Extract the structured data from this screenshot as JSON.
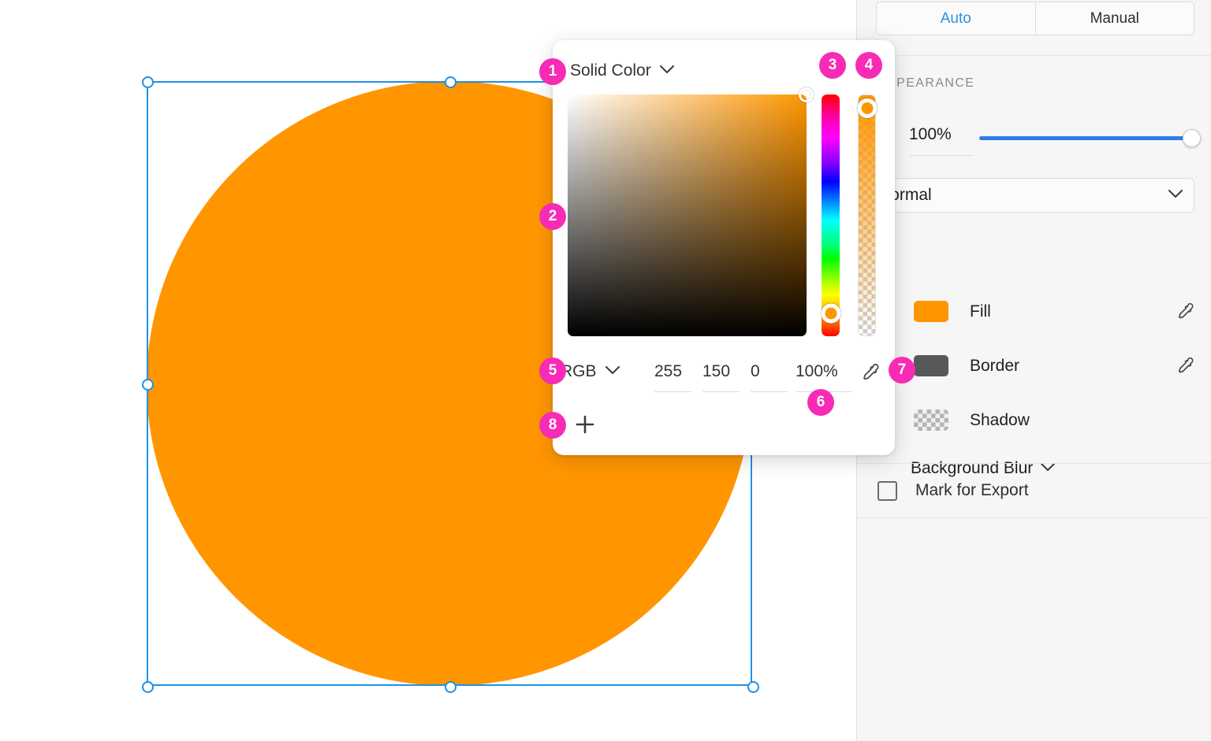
{
  "app": {
    "canvas": {
      "background_color": "#ffffff",
      "shape": {
        "name": "ellipse",
        "fill_color": "#ff9600",
        "selected": true,
        "selection_stroke_color": "#1e90e8",
        "handle_count": 8
      }
    }
  },
  "sidebar": {
    "segmented_control": {
      "options": [
        "Auto",
        "Manual"
      ],
      "selected": "Auto",
      "auto_label": "Auto",
      "manual_label": "Manual",
      "active_color": "#2f8fe8"
    },
    "appearance": {
      "section_title": "APPEARANCE",
      "opacity_value": "100%",
      "opacity_percent": 100,
      "blend_mode": "Normal",
      "layers": [
        {
          "label": "Fill",
          "swatch_color": "#ff9600",
          "swatch_type": "solid",
          "eyedropper": true
        },
        {
          "label": "Border",
          "swatch_color": "#585858",
          "swatch_type": "solid",
          "eyedropper": true
        },
        {
          "label": "Shadow",
          "swatch_color": "transparent",
          "swatch_type": "checker",
          "eyedropper": false
        }
      ],
      "background_blur_label": "Background Blur"
    },
    "export": {
      "label": "Mark for Export",
      "checked": false
    }
  },
  "color_popup": {
    "type_label": "Solid Color",
    "color_model": "RGB",
    "values": {
      "r": "255",
      "g": "150",
      "b": "0",
      "alpha": "100%"
    },
    "current_color_hex": "#ff9600",
    "hue_degrees": 35,
    "saturation": 100,
    "brightness": 100,
    "eyedropper_label": "eyedropper",
    "add_stop_label": "+"
  },
  "callouts": [
    {
      "number": "1",
      "target": "solid-color-dropdown"
    },
    {
      "number": "2",
      "target": "sv-panel"
    },
    {
      "number": "3",
      "target": "hue-slider"
    },
    {
      "number": "4",
      "target": "alpha-slider"
    },
    {
      "number": "5",
      "target": "color-model-dropdown"
    },
    {
      "number": "6",
      "target": "alpha-input"
    },
    {
      "number": "7",
      "target": "popup-eyedropper"
    },
    {
      "number": "8",
      "target": "add-stop-button"
    }
  ],
  "colors": {
    "badge_pink": "#f72bb5",
    "accent_blue": "#2f7fe8",
    "selection_blue": "#1e90e8",
    "orange": "#ff9600"
  }
}
